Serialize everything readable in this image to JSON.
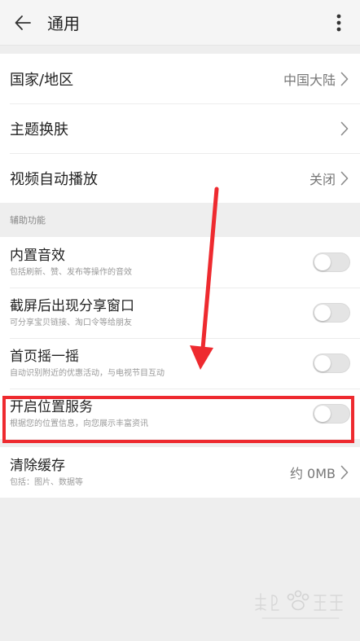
{
  "header": {
    "title": "通用"
  },
  "general": {
    "country": {
      "title": "国家/地区",
      "value": "中国大陆"
    },
    "theme": {
      "title": "主题换肤"
    },
    "autoplay": {
      "title": "视频自动播放",
      "value": "关闭"
    }
  },
  "assist": {
    "section_label": "辅助功能",
    "items": [
      {
        "title": "内置音效",
        "subtitle": "包括刷新、赞、发布等操作的音效",
        "enabled": false
      },
      {
        "title": "截屏后出现分享窗口",
        "subtitle": "可分享宝贝链接、淘口令等给朋友",
        "enabled": false
      },
      {
        "title": "首页摇一摇",
        "subtitle": "自动识别附近的优惠活动，与电视节目互动",
        "enabled": false
      },
      {
        "title": "开启位置服务",
        "subtitle": "根据您的位置信息，向您展示丰富资讯",
        "enabled": false
      }
    ]
  },
  "cache": {
    "title": "清除缓存",
    "subtitle": "包括：图片、数据等",
    "value": "约 0MB"
  },
  "colors": {
    "annotation_red": "#ee2a2f",
    "background": "#eeeeee",
    "toggle_off": "#e4e4e4"
  }
}
